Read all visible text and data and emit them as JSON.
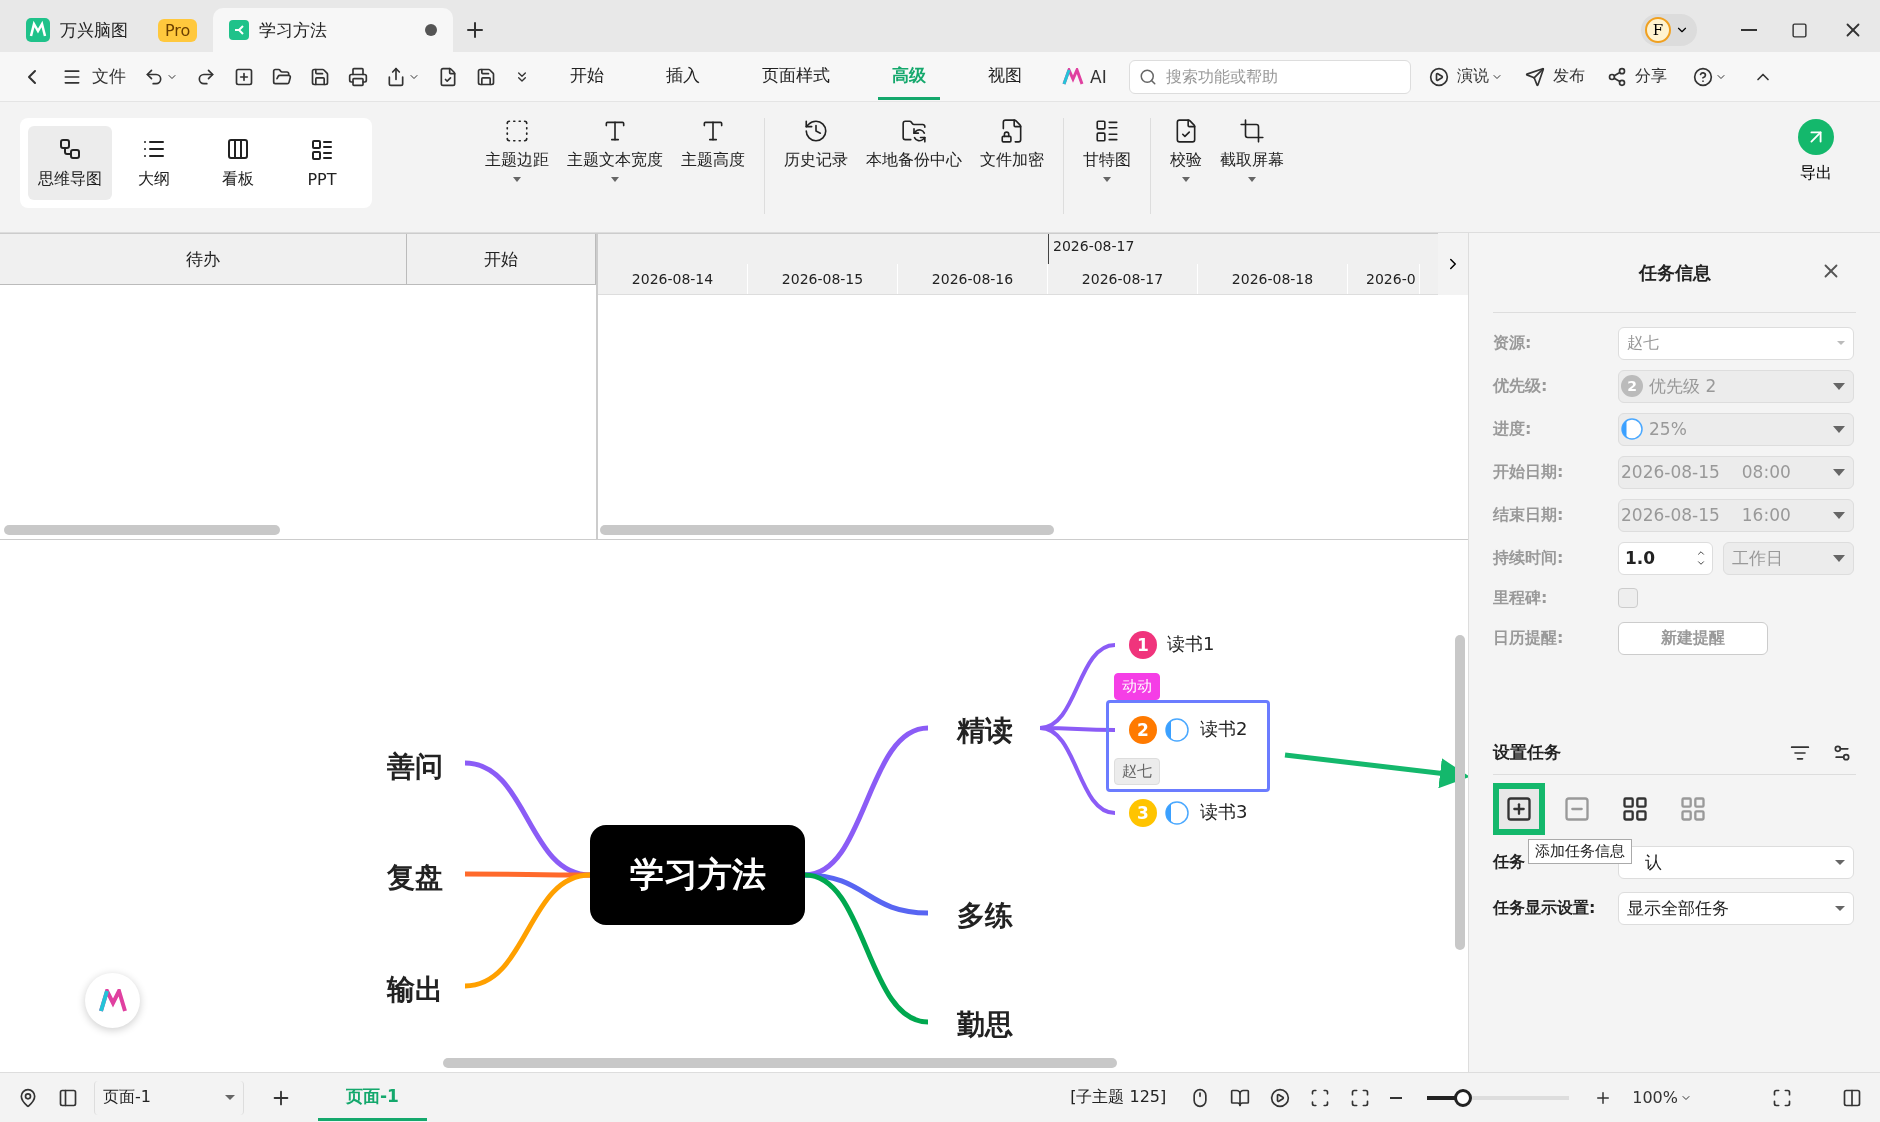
{
  "tabs": [
    {
      "kind": "app",
      "label": "万兴脑图",
      "badge": "Pro",
      "selected": false
    },
    {
      "kind": "doc",
      "label": "学习方法",
      "unsaved": true,
      "selected": true
    }
  ],
  "user": {
    "initial": "F"
  },
  "toolbar": {
    "file": "文件",
    "menus": [
      {
        "label": "开始",
        "selected": false
      },
      {
        "label": "插入",
        "selected": false
      },
      {
        "label": "页面样式",
        "selected": false
      },
      {
        "label": "高级",
        "selected": true
      },
      {
        "label": "视图",
        "selected": false
      }
    ],
    "ai": "AI",
    "search": {
      "placeholder": "搜索功能或帮助"
    },
    "actions": [
      {
        "kind": "present",
        "label": "演说"
      },
      {
        "kind": "publish",
        "label": "发布"
      },
      {
        "kind": "share",
        "label": "分享"
      }
    ]
  },
  "ribbon": {
    "views": [
      {
        "kind": "mindmap",
        "label": "思维导图",
        "selected": true
      },
      {
        "kind": "outline",
        "label": "大纲",
        "selected": false
      },
      {
        "kind": "kanban",
        "label": "看板",
        "selected": false
      },
      {
        "kind": "ppt",
        "label": "PPT",
        "selected": false
      }
    ],
    "groups": [
      [
        {
          "kind": "margin",
          "label": "主题边距",
          "dropdown": true
        },
        {
          "kind": "textwidth",
          "label": "主题文本宽度",
          "dropdown": true
        },
        {
          "kind": "height",
          "label": "主题高度",
          "dropdown": false
        }
      ],
      [
        {
          "kind": "history",
          "label": "历史记录",
          "dropdown": false
        },
        {
          "kind": "backup",
          "label": "本地备份中心",
          "dropdown": false
        },
        {
          "kind": "encrypt",
          "label": "文件加密",
          "dropdown": false
        }
      ],
      [
        {
          "kind": "gantt",
          "label": "甘特图",
          "dropdown": true
        }
      ],
      [
        {
          "kind": "check",
          "label": "校验",
          "dropdown": true
        },
        {
          "kind": "screenshot",
          "label": "截取屏幕",
          "dropdown": true
        }
      ]
    ],
    "export": "导出"
  },
  "gantt": {
    "columns": [
      "待办",
      "开始"
    ],
    "month": "2026-08-17",
    "dates": [
      "2026-08-14",
      "2026-08-15",
      "2026-08-16",
      "2026-08-17",
      "2026-08-18",
      "2026-0"
    ]
  },
  "mindmap": {
    "root": "学习方法",
    "left": [
      {
        "label": "善问",
        "color": "#8b5cf6"
      },
      {
        "label": "复盘",
        "color": "#ff6a2b"
      },
      {
        "label": "输出",
        "color": "#ffa000"
      }
    ],
    "right": [
      {
        "label": "精读",
        "color": "#8b5cf6",
        "children": [
          {
            "label": "读书1",
            "priority": "1",
            "color": "#f0347c",
            "tag": {
              "label": "动动",
              "color": "#f53ee6"
            },
            "selected": false
          },
          {
            "label": "读书2",
            "priority": "2",
            "color": "#ff7a00",
            "level": 0.25,
            "tag": {
              "label": "赵七",
              "color": "#ececec"
            },
            "selected": true
          },
          {
            "label": "读书3",
            "priority": "3",
            "color": "#ffc400",
            "level": 0.25,
            "selected": false
          }
        ]
      },
      {
        "label": "多练",
        "color": "#5865f2"
      },
      {
        "label": "勤思",
        "color": "#00a84f"
      }
    ]
  },
  "panel": {
    "title": "任务信息",
    "fields": [
      {
        "label": "资源:",
        "kind": "select",
        "value": "赵七",
        "disabled": false
      },
      {
        "label": "优先级:",
        "kind": "priority",
        "badge": "2",
        "value": "优先级 2",
        "disabled": true
      },
      {
        "label": "进度:",
        "kind": "progress",
        "level": 0.25,
        "value": "25%",
        "disabled": true
      },
      {
        "label": "开始日期:",
        "kind": "datetime",
        "date": "2026-08-15",
        "time": "08:00",
        "disabled": true
      },
      {
        "label": "结束日期:",
        "kind": "datetime",
        "date": "2026-08-15",
        "time": "16:00",
        "disabled": true
      },
      {
        "label": "持续时间:",
        "kind": "duration",
        "value": "1.0",
        "unit": "工作日"
      },
      {
        "label": "里程碑:",
        "kind": "checkbox",
        "checked": false
      },
      {
        "label": "日历提醒:",
        "kind": "button",
        "button": "新建提醒"
      }
    ],
    "task_title": "设置任务",
    "task_buttons": [
      {
        "kind": "add",
        "highlighted": true,
        "disabled": false
      },
      {
        "kind": "remove",
        "highlighted": false,
        "disabled": true
      },
      {
        "kind": "add-group",
        "highlighted": false,
        "disabled": false
      },
      {
        "kind": "remove-group",
        "highlighted": false,
        "disabled": true
      }
    ],
    "tooltip": "添加任务信息",
    "settings": [
      {
        "label": "任务",
        "value": "认"
      },
      {
        "label": "任务显示设置:",
        "value": "显示全部任务"
      }
    ]
  },
  "status_bar": {
    "page_select": "页面-1",
    "pages": [
      {
        "label": "页面-1",
        "selected": true
      }
    ],
    "count": "[子主题 125]",
    "zoom": {
      "level": 0.25,
      "reading": "100%"
    }
  }
}
